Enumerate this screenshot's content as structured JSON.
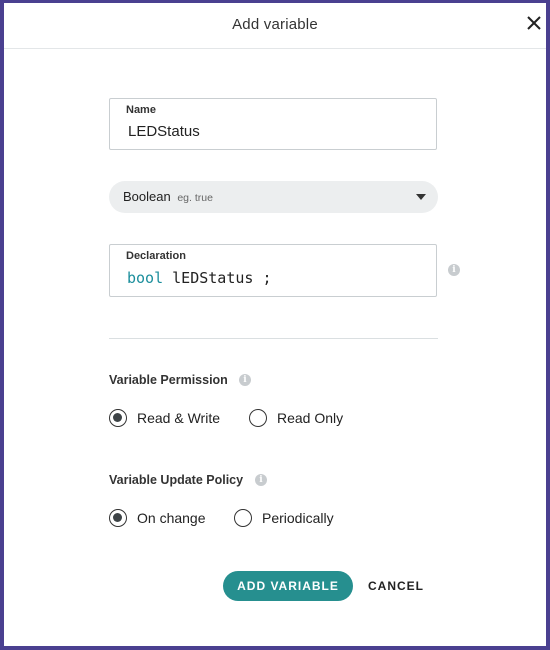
{
  "dialog": {
    "title": "Add variable",
    "close_icon": "close-icon"
  },
  "name_field": {
    "label": "Name",
    "value": "LEDStatus"
  },
  "type_select": {
    "selected": "Boolean",
    "hint": "eg. true"
  },
  "declaration": {
    "label": "Declaration",
    "keyword": "bool",
    "identifier": "lEDStatus",
    "terminator": ";"
  },
  "permission": {
    "label": "Variable Permission",
    "options": [
      {
        "label": "Read & Write",
        "checked": true
      },
      {
        "label": "Read Only",
        "checked": false
      }
    ]
  },
  "update_policy": {
    "label": "Variable Update Policy",
    "options": [
      {
        "label": "On change",
        "checked": true
      },
      {
        "label": "Periodically",
        "checked": false
      }
    ]
  },
  "actions": {
    "add_label": "ADD VARIABLE",
    "cancel_label": "CANCEL"
  },
  "colors": {
    "accent": "#268f8f",
    "code_keyword": "#1b8e9c",
    "frame": "#4a4090"
  }
}
